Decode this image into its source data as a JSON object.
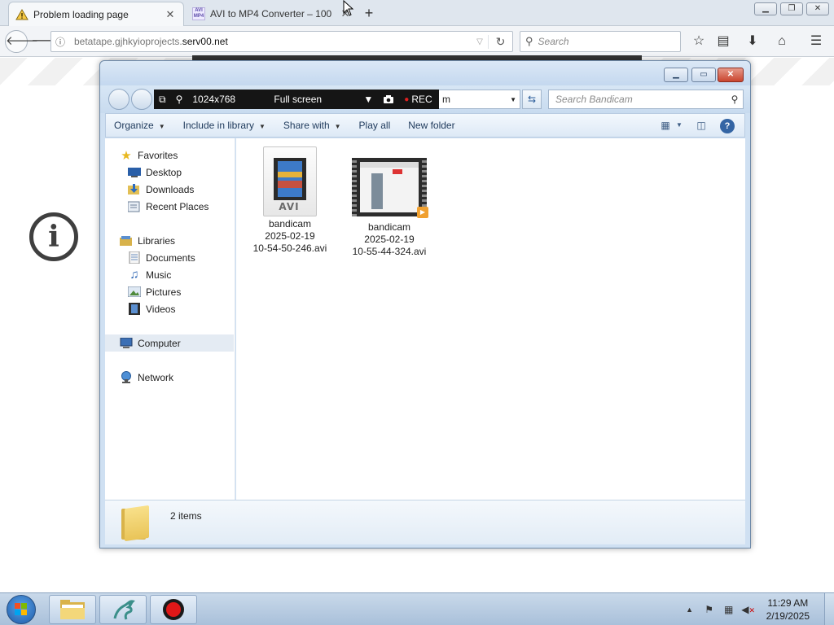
{
  "browser": {
    "tabs": [
      {
        "label": "Problem loading page",
        "icon": "warning-icon",
        "active": true
      },
      {
        "label": "AVI to MP4 Converter – 100",
        "icon": "avi-mp4-icon",
        "active": false
      }
    ],
    "new_tab_symbol": "+",
    "url_host_prefix": "betatape.gjhkyioprojects.",
    "url_host_domain": "serv00.net",
    "search_placeholder": "Search",
    "window_controls": [
      "minimize",
      "restore",
      "close"
    ]
  },
  "page": {
    "icon": "info-icon",
    "info_glyph": "i"
  },
  "explorer": {
    "bandicam": {
      "resolution": "1024x768",
      "mode": "Full screen",
      "rec_label": "REC"
    },
    "address_tail": "m",
    "search_placeholder": "Search Bandicam",
    "commands": [
      {
        "label": "Organize",
        "dropdown": true
      },
      {
        "label": "Include in library",
        "dropdown": true
      },
      {
        "label": "Share with",
        "dropdown": true
      },
      {
        "label": "Play all",
        "dropdown": false
      },
      {
        "label": "New folder",
        "dropdown": false
      }
    ],
    "help_glyph": "?",
    "nav": {
      "favorites_label": "Favorites",
      "favorites": [
        "Desktop",
        "Downloads",
        "Recent Places"
      ],
      "libraries_label": "Libraries",
      "libraries": [
        "Documents",
        "Music",
        "Pictures",
        "Videos"
      ],
      "computer_label": "Computer",
      "network_label": "Network"
    },
    "files": [
      {
        "line1": "bandicam",
        "line2": "2025-02-19",
        "line3": "10-54-50-246.avi",
        "thumb": "avi-file-icon",
        "thumb_text": "AVI"
      },
      {
        "line1": "bandicam",
        "line2": "2025-02-19",
        "line3": "10-55-44-324.avi",
        "thumb": "video-thumbnail"
      }
    ],
    "details": {
      "items_count": "2 items"
    }
  },
  "taskbar": {
    "apps": [
      "file-explorer",
      "app-dragon",
      "bandicam-record"
    ],
    "time": "11:29 AM",
    "date": "2/19/2025"
  }
}
